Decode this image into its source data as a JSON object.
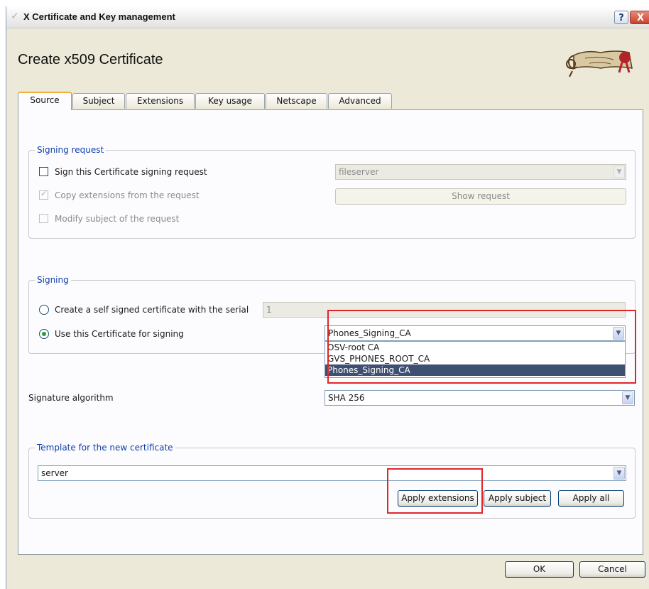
{
  "window": {
    "title": "X Certificate and Key management",
    "help": "?",
    "close": "X"
  },
  "page_title": "Create x509 Certificate",
  "tabs": [
    {
      "label": "Source",
      "active": true
    },
    {
      "label": "Subject"
    },
    {
      "label": "Extensions"
    },
    {
      "label": "Key usage"
    },
    {
      "label": "Netscape"
    },
    {
      "label": "Advanced"
    }
  ],
  "signing_request": {
    "group_label": "Signing request",
    "sign_csr": {
      "label": "Sign this Certificate signing request",
      "checked": false
    },
    "csr_select": "fileserver",
    "copy_ext": {
      "label": "Copy extensions from the request",
      "checked": true
    },
    "show_request": "Show request",
    "modify_subject": {
      "label": "Modify subject of the request",
      "checked": false
    }
  },
  "signing": {
    "group_label": "Signing",
    "self_signed": {
      "label": "Create a self signed certificate with the serial",
      "selected": false
    },
    "serial": "1",
    "use_cert": {
      "label": "Use this Certificate for signing",
      "selected": true
    },
    "ca_select": "Phones_Signing_CA",
    "ca_options": [
      "OSV-root CA",
      "GVS_PHONES_ROOT_CA",
      "Phones_Signing_CA"
    ]
  },
  "signature_algorithm": {
    "label": "Signature algorithm",
    "value": "SHA 256"
  },
  "template": {
    "group_label": "Template for the new certificate",
    "value": "server",
    "apply_extensions": "Apply extensions",
    "apply_subject": "Apply subject",
    "apply_all": "Apply all"
  },
  "footer": {
    "ok": "OK",
    "cancel": "Cancel"
  },
  "colors": {
    "highlight_box": "#e0262a",
    "selected_item": "#3f4f72",
    "group_label": "#0e3fa8"
  }
}
